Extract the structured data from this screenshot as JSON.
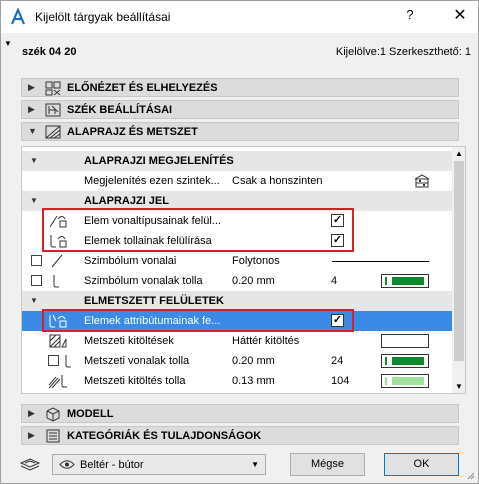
{
  "window": {
    "title": "Kijelölt tárgyak beállításai",
    "help": "?",
    "close": "✕"
  },
  "header": {
    "object_name": "szék 04 20",
    "selection_info": "Kijelölve:1 Szerkeszthető: 1"
  },
  "sections_top": [
    {
      "label": "ELŐNÉZET ÉS ELHELYEZÉS",
      "icon": "preview-placement-icon",
      "expanded": false
    },
    {
      "label": "SZÉK BEÁLLÍTÁSAI",
      "icon": "chair-settings-icon",
      "expanded": false
    },
    {
      "label": "ALAPRAJZ ÉS METSZET",
      "icon": "floorplan-section-icon",
      "expanded": true
    }
  ],
  "panel": {
    "display_group": {
      "label": "ALAPRAJZI MEGJELENÍTÉS",
      "row": {
        "name": "Megjelenítés ezen szintek...",
        "value": "Csak a honszinten"
      }
    },
    "symbol_group": {
      "label": "ALAPRAJZI JEL",
      "rows": [
        {
          "name": "Elem vonaltípusainak felül...",
          "checked": true
        },
        {
          "name": "Elemek tollainak felülírása",
          "checked": true
        },
        {
          "name": "Szimbólum vonalai",
          "value": "Folytonos"
        },
        {
          "name": "Szimbólum vonalak tolla",
          "value": "0.20 mm",
          "pen": "4",
          "pen_color": "#0e8a2a"
        }
      ]
    },
    "cut_group": {
      "label": "ELMETSZETT FELÜLETEK",
      "rows": [
        {
          "name": "Elemek attribútumainak fe...",
          "checked": true
        },
        {
          "name": "Metszeti kitöltések",
          "value": "Háttér kitöltés"
        },
        {
          "name": "Metszeti vonalak tolla",
          "value": "0.20 mm",
          "pen": "24",
          "pen_color": "#0e8a2a"
        },
        {
          "name": "Metszeti kitöltés tolla",
          "value": "0.13 mm",
          "pen": "104",
          "pen_color": "#9ee09e"
        }
      ]
    }
  },
  "sections_bottom": [
    {
      "label": "MODELL",
      "icon": "model-cube-icon",
      "expanded": false
    },
    {
      "label": "KATEGÓRIÁK ÉS TULAJDONSÁGOK",
      "icon": "categories-list-icon",
      "expanded": false
    }
  ],
  "footer": {
    "layer_value": "Beltér - bútor",
    "cancel_label": "Mégse",
    "ok_label": "OK"
  },
  "check_glyph": "✓"
}
